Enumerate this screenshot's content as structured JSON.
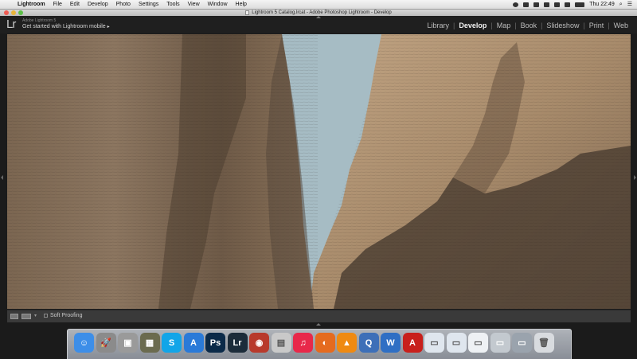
{
  "menubar": {
    "app": "Lightroom",
    "items": [
      "File",
      "Edit",
      "Develop",
      "Photo",
      "Settings",
      "Tools",
      "View",
      "Window",
      "Help"
    ],
    "clock": "Thu 22:49"
  },
  "window": {
    "title": "Lightroom 5 Catalog.lrcat - Adobe Photoshop Lightroom - Develop"
  },
  "identity": {
    "logo": "Lr",
    "product": "Adobe Lightroom 5",
    "mobile_prompt": "Get started with Lightroom mobile",
    "mobile_arrow": "▸"
  },
  "modules": [
    {
      "label": "Library",
      "active": false
    },
    {
      "label": "Develop",
      "active": true
    },
    {
      "label": "Map",
      "active": false
    },
    {
      "label": "Book",
      "active": false
    },
    {
      "label": "Slideshow",
      "active": false
    },
    {
      "label": "Print",
      "active": false
    },
    {
      "label": "Web",
      "active": false
    }
  ],
  "toolbar": {
    "soft_proofing": "Soft Proofing"
  },
  "dock": {
    "items": [
      {
        "name": "finder-icon",
        "glyph": "☺",
        "color": "#3d8ee8"
      },
      {
        "name": "launchpad-icon",
        "glyph": "🚀",
        "color": "#8b8b8b"
      },
      {
        "name": "preview-icon",
        "glyph": "▣",
        "color": "#9a9a9a"
      },
      {
        "name": "photo-browser-icon",
        "glyph": "▦",
        "color": "#6b6b4f"
      },
      {
        "name": "skype-icon",
        "glyph": "S",
        "color": "#12a5e8"
      },
      {
        "name": "app-store-icon",
        "glyph": "A",
        "color": "#2a7ad8"
      },
      {
        "name": "photoshop-icon",
        "glyph": "Ps",
        "color": "#0b2a49"
      },
      {
        "name": "lightroom-icon",
        "glyph": "Lr",
        "color": "#1c2c3a"
      },
      {
        "name": "photo-booth-icon",
        "glyph": "◉",
        "color": "#b83a2c"
      },
      {
        "name": "utilities-icon",
        "glyph": "▤",
        "color": "#c9c9c9"
      },
      {
        "name": "itunes-icon",
        "glyph": "♫",
        "color": "#e8284a"
      },
      {
        "name": "firefox-icon",
        "glyph": "◐",
        "color": "#e56b1f"
      },
      {
        "name": "vlc-icon",
        "glyph": "▲",
        "color": "#ef8a12"
      },
      {
        "name": "quicktime-icon",
        "glyph": "Q",
        "color": "#3d6fb8"
      },
      {
        "name": "word-icon",
        "glyph": "W",
        "color": "#2f6fc4"
      },
      {
        "name": "acrobat-icon",
        "glyph": "A",
        "color": "#c8201c"
      },
      {
        "name": "minimized-window-1-icon",
        "glyph": "▭",
        "color": "#dfe6ee"
      },
      {
        "name": "minimized-window-2-icon",
        "glyph": "▭",
        "color": "#dfe6ee"
      },
      {
        "name": "minimized-window-3-icon",
        "glyph": "▭",
        "color": "#eef1f4"
      },
      {
        "name": "minimized-window-4-icon",
        "glyph": "▭",
        "color": "#c3c9cf"
      },
      {
        "name": "minimized-window-5-icon",
        "glyph": "▭",
        "color": "#9aa3ad"
      },
      {
        "name": "trash-icon",
        "glyph": "🗑",
        "color": "#d8dbdf"
      }
    ]
  },
  "colors": {
    "accent_module": "#f2f2f2",
    "lr_background": "#1f1f1f",
    "sky": "#a7bcc3",
    "rock_light": "#b39878",
    "rock_dark": "#5a4a3a"
  }
}
